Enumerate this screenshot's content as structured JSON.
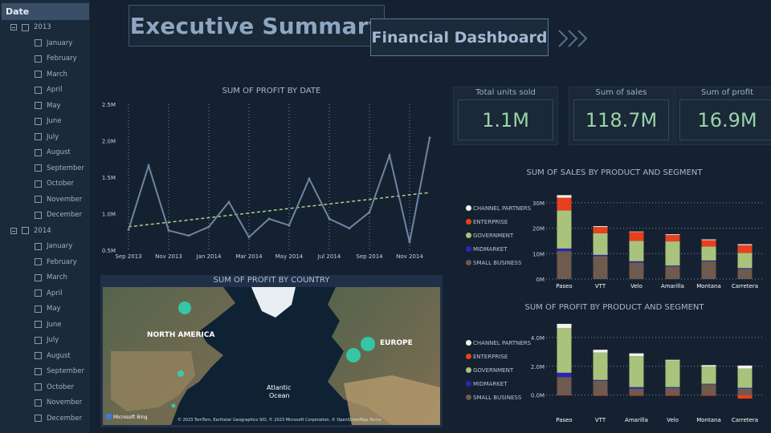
{
  "slicer": {
    "header": "Date",
    "years": [
      {
        "label": "2013",
        "months": [
          "January",
          "February",
          "March",
          "April",
          "May",
          "June",
          "July",
          "August",
          "September",
          "October",
          "November",
          "December"
        ]
      },
      {
        "label": "2014",
        "months": [
          "January",
          "February",
          "March",
          "April",
          "May",
          "June",
          "July",
          "August",
          "September",
          "October",
          "November",
          "December"
        ]
      }
    ]
  },
  "header": {
    "title": "Executive Summary",
    "subtitle": "Financial Dashboard"
  },
  "kpis": [
    {
      "label": "Total units sold",
      "value": "1.1M"
    },
    {
      "label": "Sum of sales",
      "value": "118.7M"
    },
    {
      "label": "Sum of profit",
      "value": "16.9M"
    }
  ],
  "legend": [
    "CHANNEL PARTNERS",
    "ENTERPRISE",
    "GOVERNMENT",
    "MIDMARKET",
    "SMALL BUSINESS"
  ],
  "colors": {
    "channel_partners": "#f2f2ee",
    "enterprise": "#e8401c",
    "government": "#a9c27c",
    "midmarket": "#2727b8",
    "small_business": "#6e5a4f",
    "line": "#6d85a3",
    "trend": "#a8d08d",
    "kpi_value": "#9ad3a8"
  },
  "map": {
    "title": "SUM OF PROFIT BY COUNTRY",
    "labels": {
      "north_america": "NORTH AMERICA",
      "europe": "EUROPE",
      "ocean_line1": "Atlantic",
      "ocean_line2": "Ocean"
    },
    "brand": "Microsoft Bing",
    "attribution": "© 2023 TomTom, Earthstar Geographics SIO, © 2023 Microsoft Corporation, © OpenStreetMap  Terms"
  },
  "chart_data": [
    {
      "type": "line",
      "title": "SUM OF PROFIT BY DATE",
      "x": [
        "Sep 2013",
        "Oct 2013",
        "Nov 2013",
        "Dec 2013",
        "Jan 2014",
        "Feb 2014",
        "Mar 2014",
        "Apr 2014",
        "May 2014",
        "Jun 2014",
        "Jul 2014",
        "Aug 2014",
        "Sep 2014",
        "Oct 2014",
        "Nov 2014",
        "Dec 2014"
      ],
      "x_tick_labels": [
        "Sep 2013",
        "Nov 2013",
        "Jan 2014",
        "Mar 2014",
        "May 2014",
        "Jul 2014",
        "Sep 2014",
        "Nov 2014"
      ],
      "series": [
        {
          "values": [
            0.78,
            1.66,
            0.77,
            0.7,
            0.82,
            1.16,
            0.68,
            0.93,
            0.84,
            1.48,
            0.93,
            0.8,
            1.02,
            1.8,
            0.61,
            2.04
          ]
        }
      ],
      "trend": [
        0.82,
        1.29
      ],
      "y_tick_labels": [
        "0.5M",
        "1.0M",
        "1.5M",
        "2.0M",
        "2.5M"
      ],
      "ylim": [
        0.5,
        2.5
      ],
      "grid": true
    },
    {
      "type": "bar",
      "stacked": true,
      "title": "SUM OF SALES BY PRODUCT AND SEGMENT",
      "categories": [
        "Paseo",
        "VTT",
        "Velo",
        "Amarilla",
        "Montana",
        "Carretera"
      ],
      "series": [
        {
          "name": "SMALL BUSINESS",
          "values": [
            11,
            9,
            6.5,
            5,
            7,
            4
          ]
        },
        {
          "name": "MIDMARKET",
          "values": [
            1,
            0.5,
            0.5,
            0.3,
            0.3,
            0.3
          ]
        },
        {
          "name": "GOVERNMENT",
          "values": [
            15,
            8.5,
            8,
            9.5,
            5.5,
            6
          ]
        },
        {
          "name": "ENTERPRISE",
          "values": [
            5,
            2.5,
            3.5,
            2.5,
            2.5,
            3
          ]
        },
        {
          "name": "CHANNEL PARTNERS",
          "values": [
            1,
            0.3,
            0.2,
            0.3,
            0.3,
            0.4
          ]
        }
      ],
      "y_tick_labels": [
        "0M",
        "10M",
        "20M",
        "30M"
      ],
      "ylim": [
        0,
        35
      ],
      "grid": true,
      "legend": "left"
    },
    {
      "type": "bar",
      "stacked": true,
      "title": "SUM OF PROFIT BY PRODUCT AND SEGMENT",
      "categories": [
        "Paseo",
        "VTT",
        "Amarilla",
        "Velo",
        "Montana",
        "Carretera"
      ],
      "series": [
        {
          "name": "SMALL BUSINESS",
          "values": [
            1.25,
            1.0,
            0.45,
            0.5,
            0.75,
            0.45
          ]
        },
        {
          "name": "MIDMARKET",
          "values": [
            0.3,
            0.05,
            0.1,
            0.05,
            0.03,
            0.05
          ]
        },
        {
          "name": "GOVERNMENT",
          "values": [
            3.1,
            1.9,
            2.15,
            1.85,
            1.2,
            1.35
          ]
        },
        {
          "name": "ENTERPRISE",
          "values": [
            -0.03,
            -0.05,
            -0.05,
            -0.05,
            -0.05,
            -0.25
          ]
        },
        {
          "name": "CHANNEL PARTNERS",
          "values": [
            0.3,
            0.2,
            0.2,
            0.05,
            0.1,
            0.2
          ]
        }
      ],
      "y_tick_labels": [
        "0.0M",
        "2.0M",
        "4.0M"
      ],
      "ylim": [
        -0.3,
        5
      ],
      "grid": true,
      "legend": "left"
    }
  ]
}
